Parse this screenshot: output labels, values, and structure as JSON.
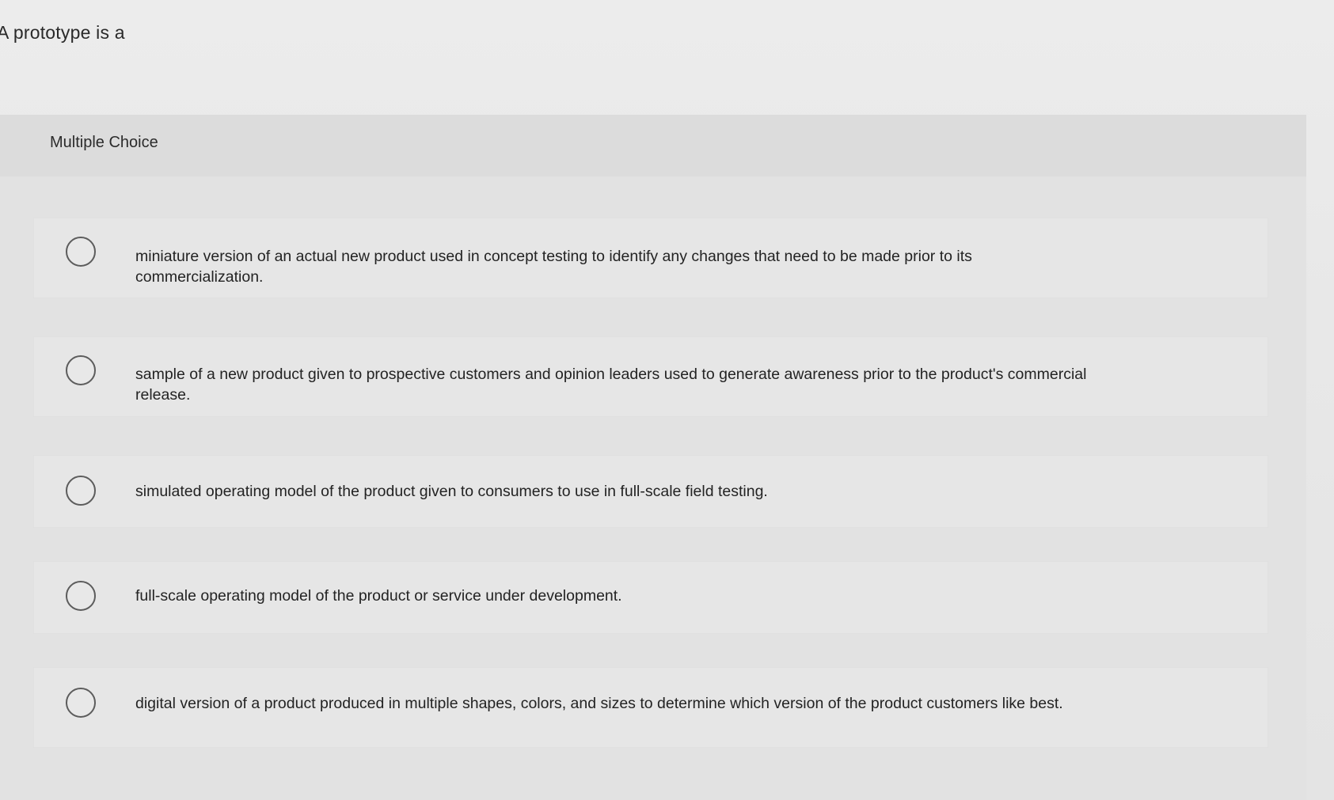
{
  "question": {
    "text": "A prototype is a"
  },
  "quiz": {
    "type_label": "Multiple Choice",
    "options": [
      {
        "label": "miniature version of an actual new product used in concept testing to identify any changes that need to be made prior to its commercialization."
      },
      {
        "label": "sample of a new product given to prospective customers and opinion leaders used to generate awareness prior to the product's commercial release."
      },
      {
        "label": "simulated operating model of the product given to consumers to use in full-scale field testing."
      },
      {
        "label": "full-scale operating model of the product or service under development."
      },
      {
        "label": "digital version of a product produced in multiple shapes, colors, and sizes to determine which version of the product customers like best."
      }
    ]
  },
  "icons": {
    "radio": "radio-unchecked-icon"
  }
}
